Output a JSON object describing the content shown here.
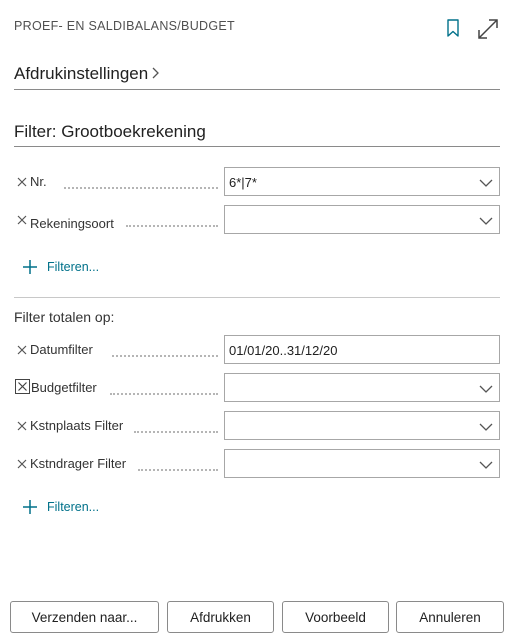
{
  "header": {
    "title": "PROEF- EN SALDIBALANS/BUDGET",
    "bookmark_icon": "bookmark-icon",
    "expand_icon": "expand-icon"
  },
  "print_settings": {
    "label": "Afdrukinstellingen"
  },
  "filter_section": {
    "title": "Filter: Grootboekrekening",
    "fields": [
      {
        "label": "Nr.",
        "value": "6*|7*"
      },
      {
        "label": "Rekeningsoort",
        "value": ""
      }
    ],
    "add_filter_label": "Filteren..."
  },
  "totals_section": {
    "title": "Filter totalen op:",
    "fields": [
      {
        "label": "Datumfilter",
        "value": "01/01/20..31/12/20"
      },
      {
        "label": "Budgetfilter",
        "value": ""
      },
      {
        "label": "Kstnplaats Filter",
        "value": ""
      },
      {
        "label": "Kstndrager Filter",
        "value": ""
      }
    ],
    "add_filter_label": "Filteren..."
  },
  "footer": {
    "send_label": "Verzenden naar...",
    "print_label": "Afdrukken",
    "preview_label": "Voorbeeld",
    "cancel_label": "Annuleren"
  },
  "colors": {
    "accent": "#00718a",
    "border": "#a7a7a7",
    "text": "#212121"
  }
}
